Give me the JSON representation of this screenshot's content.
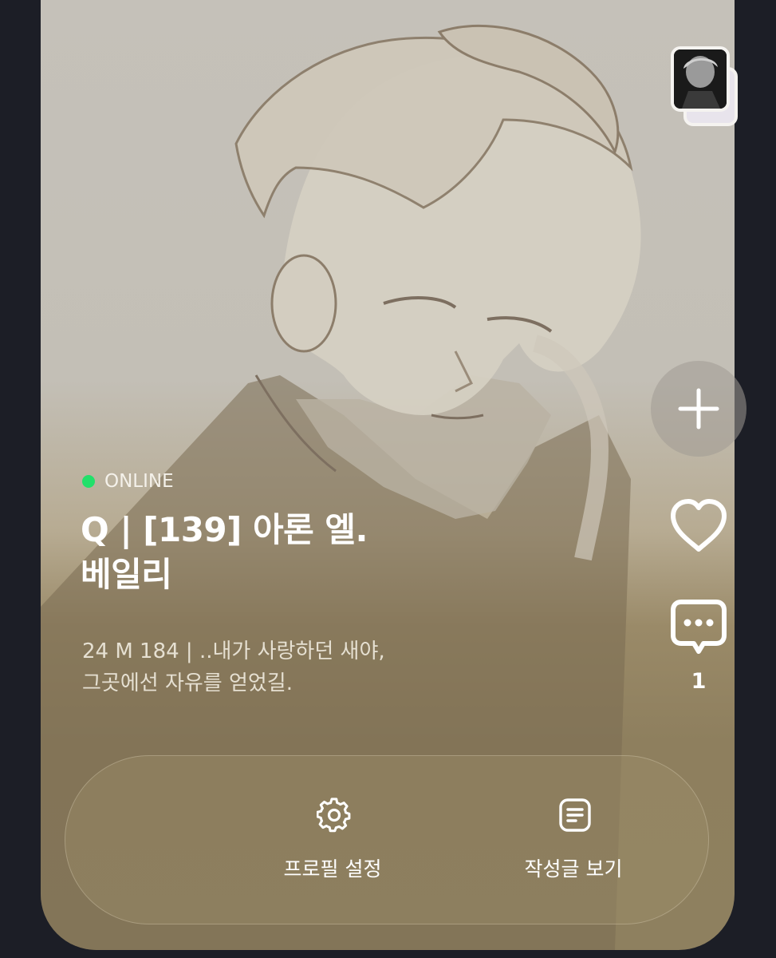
{
  "status": {
    "label": "ONLINE",
    "color": "#22e06a"
  },
  "profile": {
    "title_line1": "Q | [139] 아론 엘.",
    "title_line2": "베일리",
    "desc_line1": "24 M 184 | ..내가 사랑하던 새야,",
    "desc_line2": "그곳에선 자유를 얻었길."
  },
  "actions": {
    "add_icon": "plus-icon",
    "like_icon": "heart-icon",
    "comment_icon": "speech-bubble-icon",
    "comment_count": "1"
  },
  "bottom_bar": {
    "profile_settings_label": "프로필 설정",
    "profile_settings_icon": "gear-icon",
    "view_posts_label": "작성글 보기",
    "view_posts_icon": "document-icon"
  },
  "colors": {
    "background": "#1c1e26",
    "card_top": "#c5c1b9",
    "card_bottom": "#8e805f",
    "text": "#ffffff"
  }
}
